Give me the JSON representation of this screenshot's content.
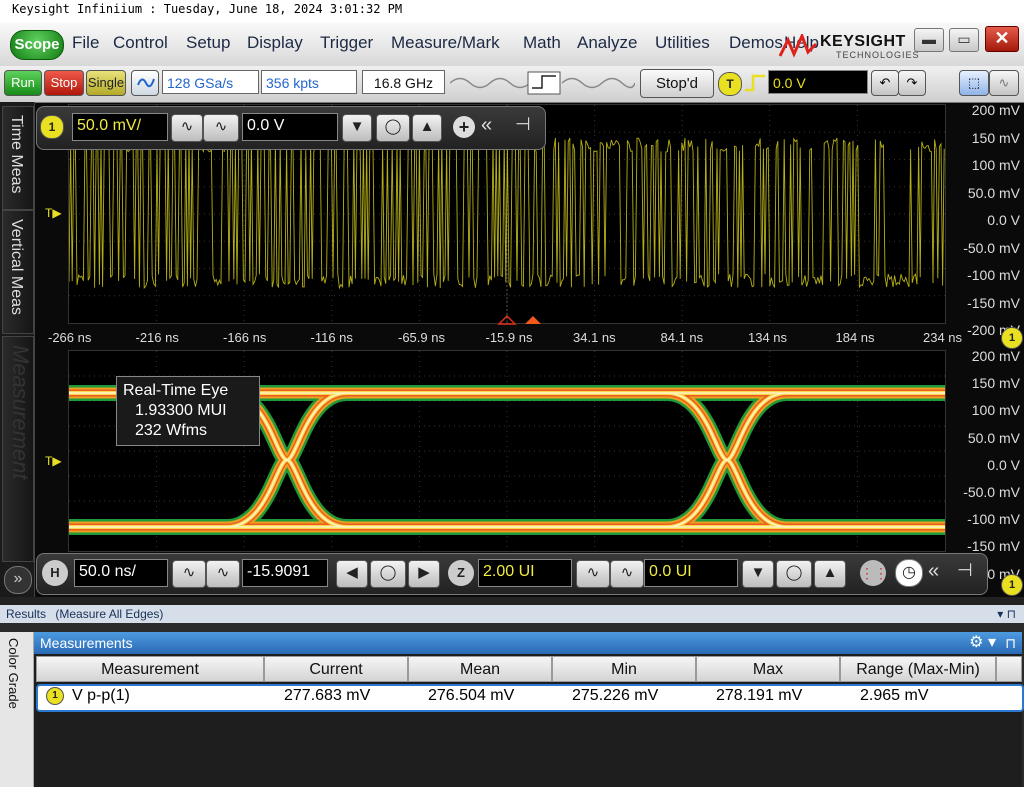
{
  "window": {
    "caption": "Keysight Infiniium : Tuesday, June 18, 2024 3:01:32 PM",
    "scope_label": "Scope",
    "menus": [
      "File",
      "Control",
      "Setup",
      "Display",
      "Trigger",
      "Measure/Mark",
      "Math",
      "Analyze",
      "Utilities",
      "Demos",
      "Help"
    ],
    "logo": "KEYSIGHT",
    "logo_sub": "TECHNOLOGIES",
    "minimize": "▬",
    "maximize": "▭",
    "close": "✕"
  },
  "toolbar": {
    "run": "Run",
    "stop": "Stop",
    "single": "Single",
    "sample_rate": "128 GSa/s",
    "memory_depth": "356 kpts",
    "bandwidth": "16.8 GHz",
    "status": "Stop'd",
    "trigger_label": "T",
    "trigger_level": "0.0 V"
  },
  "side_tabs": {
    "time_meas": "Time Meas",
    "vertical_meas": "Vertical Meas",
    "measurement": "Measurement",
    "expand": "»"
  },
  "channel1": {
    "id": "1",
    "scale": "50.0 mV/",
    "offset": "0.0 V"
  },
  "upper_y_labels": [
    "200 mV",
    "150 mV",
    "100 mV",
    "50.0 mV",
    "0.0 V",
    "-50.0 mV",
    "-100 mV",
    "-150 mV",
    "-200 mV"
  ],
  "lower_y_labels": [
    "200 mV",
    "150 mV",
    "100 mV",
    "50.0 mV",
    "0.0 V",
    "-50.0 mV",
    "-100 mV",
    "-150 mV",
    "-200 mV"
  ],
  "x_labels": [
    "-266 ns",
    "-216 ns",
    "-166 ns",
    "-116 ns",
    "-65.9 ns",
    "-15.9 ns",
    "34.1 ns",
    "84.1 ns",
    "134 ns",
    "184 ns",
    "234 ns"
  ],
  "eye": {
    "title": "Real-Time Eye",
    "ui": "1.93300 MUI",
    "wfms": "232 Wfms"
  },
  "horizontal": {
    "label": "H",
    "scale": "50.0 ns/",
    "position": "-15.9091",
    "zoom_label": "Z",
    "ui_scale": "2.00 UI",
    "ui_offset": "0.0 UI"
  },
  "results": {
    "tab": "Results",
    "subtitle": "(Measure All Edges)",
    "panel_title": "Measurements",
    "side_label": "Color Grade",
    "columns": [
      "Measurement",
      "Current",
      "Mean",
      "Min",
      "Max",
      "Range (Max-Min)"
    ],
    "row": {
      "channel": "1",
      "name": "V p-p(1)",
      "current": "277.683 mV",
      "mean": "276.504 mV",
      "min": "275.226 mV",
      "max": "278.191 mV",
      "range": "2.965 mV"
    }
  },
  "colors": {
    "channel1": "#e8e020",
    "trace": "#c9c21a",
    "accent": "#2a78d0"
  }
}
